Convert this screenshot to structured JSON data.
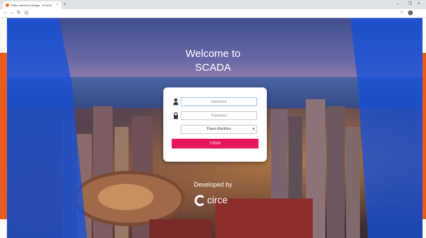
{
  "browser": {
    "tab_title": "Paseo Marítimo Málaga - SCADA",
    "tab_close": "×",
    "new_tab": "+",
    "window_controls": [
      "–",
      "❐",
      "×"
    ],
    "nav": [
      "←",
      "→",
      "↻",
      "◎"
    ],
    "toolbar_right": [
      "☆"
    ]
  },
  "page": {
    "welcome_line1": "Welcome to",
    "welcome_line2": "SCADA",
    "username_placeholder": "Username",
    "password_placeholder": "Password",
    "site_selected": "Paseo Marítimo",
    "login_label": "LOGIN",
    "developed_by": "Developed by",
    "brand_name": "circe"
  },
  "colors": {
    "accent_button": "#e8155f",
    "blue_overlay": "#1450dc",
    "orange_edge": "#e85d1f"
  }
}
